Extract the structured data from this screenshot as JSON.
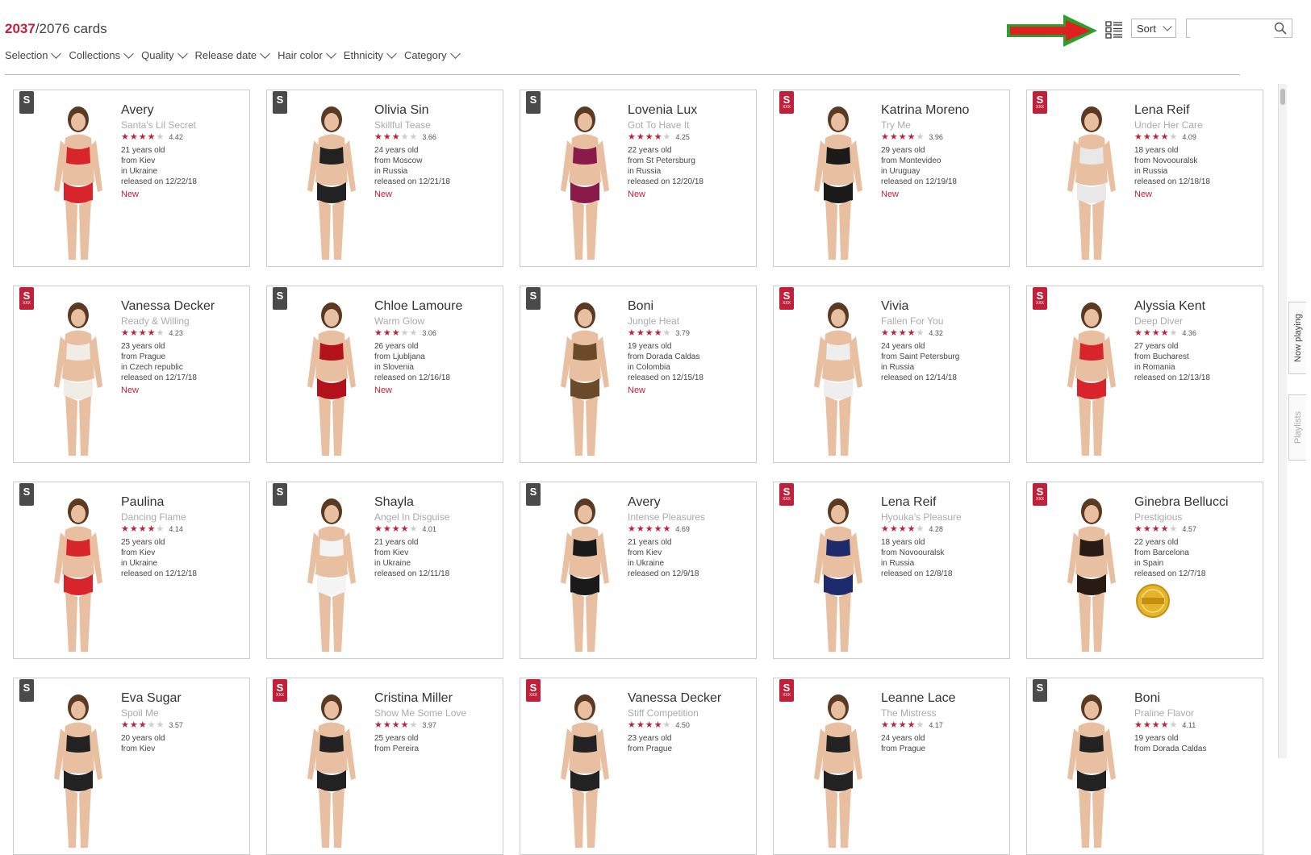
{
  "header": {
    "current_count": "2037",
    "total": "/2076 cards"
  },
  "filters": [
    "Selection",
    "Collections",
    "Quality",
    "Release date",
    "Hair color",
    "Ethnicity",
    "Category"
  ],
  "toolbar": {
    "sort_label": "Sort",
    "search_value": "",
    "search_icon": "search-icon",
    "view_icon": "grid-list-icon"
  },
  "side_tabs": [
    "Now playing",
    "Playlists"
  ],
  "colors": {
    "accent": "#c0213a",
    "badge_gray": "#4a4a4a",
    "arrow_red": "#e02020",
    "arrow_green": "#2aa02a"
  },
  "cards": [
    {
      "name": "Avery",
      "title": "Santa's Lil Secret",
      "stars": 4.5,
      "rating": "4.42",
      "age": "21 years old",
      "from": "from Kiev",
      "country": "in Ukraine",
      "released": "released on 12/22/18",
      "new": "New",
      "badge": "s",
      "outfit": "#d8242b"
    },
    {
      "name": "Olivia Sin",
      "title": "Skillful Tease",
      "stars": 3.5,
      "rating": "3.66",
      "age": "24 years old",
      "from": "from Moscow",
      "country": "in Russia",
      "released": "released on 12/21/18",
      "new": "New",
      "badge": "s",
      "outfit": "#222222"
    },
    {
      "name": "Lovenia Lux",
      "title": "Got To Have It",
      "stars": 4,
      "rating": "4.25",
      "age": "22 years old",
      "from": "from St Petersburg",
      "country": "in Russia",
      "released": "released on 12/20/18",
      "new": "New",
      "badge": "s",
      "outfit": "#8a1a4a"
    },
    {
      "name": "Katrina Moreno",
      "title": "Try Me",
      "stars": 4,
      "rating": "3.96",
      "age": "29 years old",
      "from": "from Montevideo",
      "country": "in Uruguay",
      "released": "released on 12/19/18",
      "new": "New",
      "badge": "xxx",
      "outfit": "#1a1a1a"
    },
    {
      "name": "Lena Reif",
      "title": "Under Her Care",
      "stars": 4,
      "rating": "4.09",
      "age": "18 years old",
      "from": "from Novoouralsk",
      "country": "in Russia",
      "released": "released on 12/18/18",
      "new": "New",
      "badge": "xxx",
      "outfit": "#e8e8e8"
    },
    {
      "name": "Vanessa Decker",
      "title": "Ready & Willing",
      "stars": 4,
      "rating": "4.23",
      "age": "23 years old",
      "from": "from Prague",
      "country": "in Czech republic",
      "released": "released on 12/17/18",
      "new": "New",
      "badge": "xxx",
      "outfit": "#f0ece6"
    },
    {
      "name": "Chloe Lamoure",
      "title": "Warm Glow",
      "stars": 3,
      "rating": "3.06",
      "age": "26 years old",
      "from": "from Ljubljana",
      "country": "in Slovenia",
      "released": "released on 12/16/18",
      "new": "New",
      "badge": "s",
      "outfit": "#b3121a"
    },
    {
      "name": "Boni",
      "title": "Jungle Heat",
      "stars": 4,
      "rating": "3.79",
      "age": "19 years old",
      "from": "from Dorada Caldas",
      "country": "in Colombia",
      "released": "released on 12/15/18",
      "new": "New",
      "badge": "s",
      "outfit": "#6b4a2a"
    },
    {
      "name": "Vivia",
      "title": "Fallen For You",
      "stars": 4.5,
      "rating": "4.32",
      "age": "24 years old",
      "from": "from Saint Petersburg",
      "country": "in Russia",
      "released": "released on 12/14/18",
      "new": "",
      "badge": "xxx",
      "outfit": "#eeeeee"
    },
    {
      "name": "Alyssia Kent",
      "title": "Deep Diver",
      "stars": 4.5,
      "rating": "4.36",
      "age": "27 years old",
      "from": "from Bucharest",
      "country": "in Romania",
      "released": "released on 12/13/18",
      "new": "",
      "badge": "xxx",
      "outfit": "#d8242b"
    },
    {
      "name": "Paulina",
      "title": "Dancing Flame",
      "stars": 4,
      "rating": "4.14",
      "age": "25 years old",
      "from": "from Kiev",
      "country": "in Ukraine",
      "released": "released on 12/12/18",
      "new": "",
      "badge": "s",
      "outfit": "#d8242b"
    },
    {
      "name": "Shayla",
      "title": "Angel In Disguise",
      "stars": 4,
      "rating": "4.01",
      "age": "21 years old",
      "from": "from Kiev",
      "country": "in Ukraine",
      "released": "released on 12/11/18",
      "new": "",
      "badge": "s",
      "outfit": "#f4f4f4"
    },
    {
      "name": "Avery",
      "title": "Intense Pleasures",
      "stars": 5,
      "rating": "4.69",
      "age": "21 years old",
      "from": "from Kiev",
      "country": "in Ukraine",
      "released": "released on 12/9/18",
      "new": "",
      "badge": "s",
      "outfit": "#1a1a1a"
    },
    {
      "name": "Lena Reif",
      "title": "Hyouka's Pleasure",
      "stars": 4,
      "rating": "4.28",
      "age": "18 years old",
      "from": "from Novoouralsk",
      "country": "in Russia",
      "released": "released on 12/8/18",
      "new": "",
      "badge": "xxx",
      "outfit": "#1d2a6b"
    },
    {
      "name": "Ginebra Bellucci",
      "title": "Prestigious",
      "stars": 4.5,
      "rating": "4.57",
      "age": "22 years old",
      "from": "from Barcelona",
      "country": "in Spain",
      "released": "released on 12/7/18",
      "new": "",
      "badge": "xxx",
      "outfit": "#2a1a14",
      "talent": true
    },
    {
      "name": "Eva Sugar",
      "title": "Spoil Me",
      "stars": 3.5,
      "rating": "3.57",
      "age": "20 years old",
      "from": "from Kiev",
      "country": "",
      "released": "",
      "new": "",
      "badge": "s",
      "outfit": "#222222"
    },
    {
      "name": "Cristina Miller",
      "title": "Show Me Some Love",
      "stars": 4,
      "rating": "3.97",
      "age": "25 years old",
      "from": "from Pereira",
      "country": "",
      "released": "",
      "new": "",
      "badge": "xxx",
      "outfit": "#222222"
    },
    {
      "name": "Vanessa Decker",
      "title": "Stiff Competition",
      "stars": 4.5,
      "rating": "4.50",
      "age": "23 years old",
      "from": "from Prague",
      "country": "",
      "released": "",
      "new": "",
      "badge": "xxx",
      "outfit": "#222222"
    },
    {
      "name": "Leanne Lace",
      "title": "The Mistress",
      "stars": 4,
      "rating": "4.17",
      "age": "24 years old",
      "from": "from Prague",
      "country": "",
      "released": "",
      "new": "",
      "badge": "xxx",
      "outfit": "#222222"
    },
    {
      "name": "Boni",
      "title": "Praline Flavor",
      "stars": 4,
      "rating": "4.11",
      "age": "19 years old",
      "from": "from Dorada Caldas",
      "country": "",
      "released": "",
      "new": "",
      "badge": "s",
      "outfit": "#222222"
    }
  ]
}
